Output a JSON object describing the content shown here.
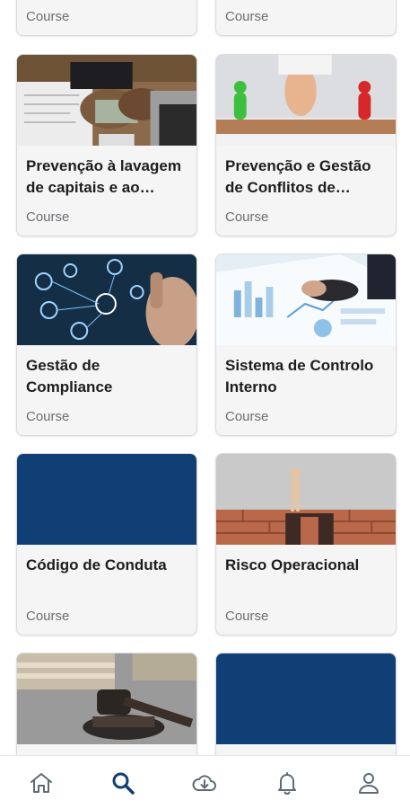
{
  "colors": {
    "accent": "#0f3f75",
    "nav_inactive": "#5f6b73",
    "card_bg": "#f5f5f6",
    "muted_text": "#6d6d72",
    "title_text": "#1d1d1f",
    "placeholder_navy": "#0f3f75"
  },
  "courses": [
    {
      "title": "",
      "type": "Course",
      "image": "none"
    },
    {
      "title": "",
      "type": "Course",
      "image": "none"
    },
    {
      "title": "Prevenção à lavagem de capitais e ao financiamento do terrorismo",
      "type": "Course",
      "image": "money-handling-photo"
    },
    {
      "title": "Prevenção e Gestão de Conflitos de Interesses",
      "type": "Course",
      "image": "balance-figures-photo"
    },
    {
      "title": "Gestão de Compliance",
      "type": "Course",
      "image": "digital-network-photo"
    },
    {
      "title": "Sistema de Controlo Interno",
      "type": "Course",
      "image": "charts-report-photo"
    },
    {
      "title": "Código de Conduta",
      "type": "Course",
      "image": "navy-placeholder"
    },
    {
      "title": "Risco Operacional",
      "type": "Course",
      "image": "bridge-gap-photo"
    },
    {
      "title": "",
      "type": "",
      "image": "gavel-books-photo"
    },
    {
      "title": "",
      "type": "",
      "image": "navy-placeholder"
    }
  ],
  "bottom_nav": [
    {
      "icon": "home-icon",
      "active": false
    },
    {
      "icon": "search-icon",
      "active": true
    },
    {
      "icon": "cloud-download-icon",
      "active": false
    },
    {
      "icon": "bell-icon",
      "active": false
    },
    {
      "icon": "profile-icon",
      "active": false
    }
  ]
}
